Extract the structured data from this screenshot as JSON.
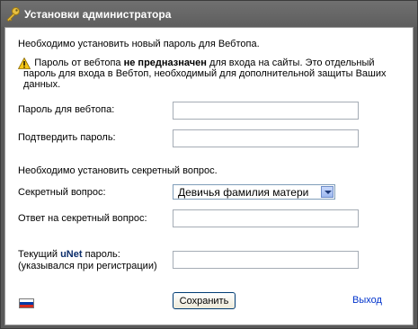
{
  "window": {
    "title": "Установки администратора"
  },
  "intro": {
    "password_notice": "Необходимо установить новый пароль для Вебтопа.",
    "warning_pre": "Пароль от вебтопа ",
    "warning_bold": "не предназначен",
    "warning_post": " для входа на сайты. Это отдельный пароль для входа в Вебтоп, необходимый для дополнительной защиты Ваших данных."
  },
  "form": {
    "webtop_password_label": "Пароль для вебтопа:",
    "webtop_password_value": "",
    "confirm_password_label": "Подтвердить пароль:",
    "confirm_password_value": "",
    "secret_notice": "Необходимо установить секретный вопрос.",
    "secret_question_label": "Секретный вопрос:",
    "secret_question_value": "Девичья фамилия матери",
    "secret_answer_label": "Ответ на секретный вопрос:",
    "secret_answer_value": "",
    "unet_label_pre": "Текущий ",
    "unet_label_bold": "uNet",
    "unet_label_post": " пароль:",
    "unet_label_hint": "(указывался при регистрации)",
    "unet_password_value": ""
  },
  "footer": {
    "save_label": "Сохранить",
    "exit_label": "Выход",
    "language_flag": "russia-flag-icon"
  },
  "colors": {
    "titlebar": "#5e5e5e",
    "link": "#0033cc",
    "flag_white": "#ffffff",
    "flag_blue": "#0039a6",
    "flag_red": "#d52b1e"
  }
}
